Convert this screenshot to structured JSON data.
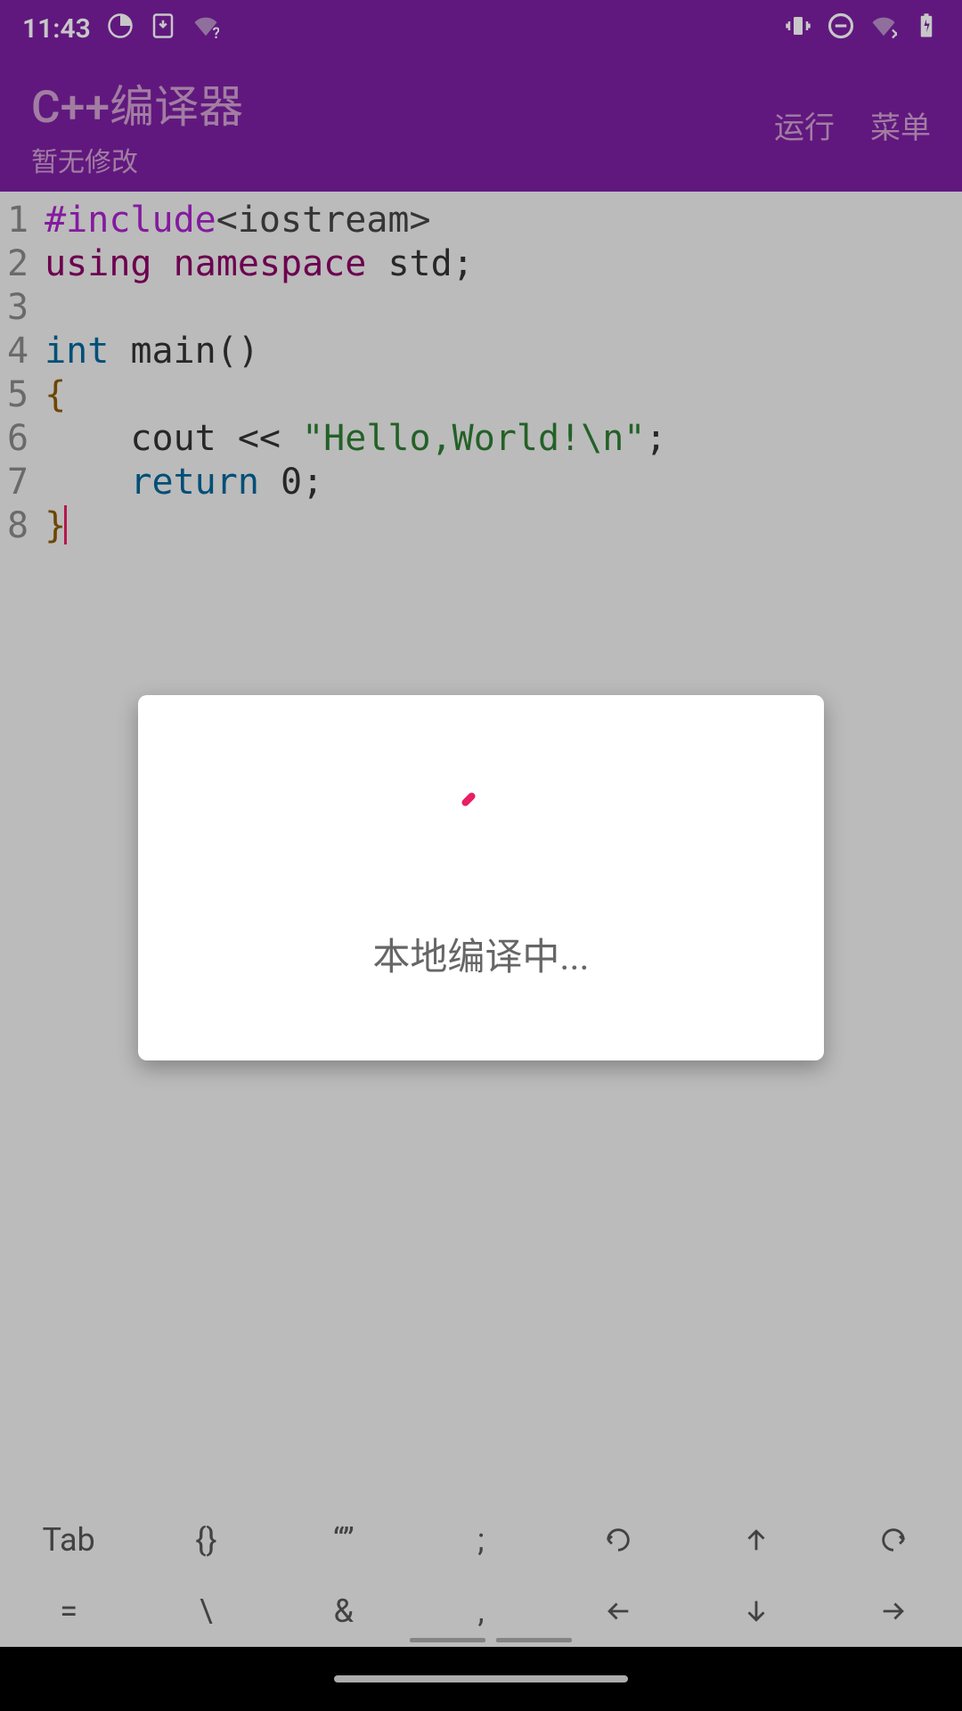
{
  "status": {
    "time": "11:43"
  },
  "appbar": {
    "title": "C++编译器",
    "subtitle": "暂无修改",
    "run": "运行",
    "menu": "菜单"
  },
  "editor": {
    "gutter": [
      "1",
      "2",
      "3",
      "4",
      "5",
      "6",
      "7",
      "8"
    ],
    "l1": {
      "include": "#include",
      "header": "<iostream>"
    },
    "l2": {
      "using": "using",
      "namespace": "namespace",
      "std": "std",
      "semi": ";"
    },
    "l3": "",
    "l4": {
      "intkw": "int",
      "main": "main()"
    },
    "l5": "{",
    "l6": {
      "indent": "    ",
      "cout": "cout << ",
      "str": "\"Hello,World!\\n\"",
      "semi": ";"
    },
    "l7": {
      "indent": "    ",
      "retkw": "return",
      "sp": " ",
      "zero": "0",
      "semi": ";"
    },
    "l8": "}"
  },
  "dialog": {
    "message": "本地编译中..."
  },
  "toolbar": {
    "r1c1": "Tab",
    "r1c2": "{}",
    "r1c3": "“”",
    "r1c4": ";",
    "r2c1": "=",
    "r2c2": "\\",
    "r2c3": "&",
    "r2c4": ","
  }
}
